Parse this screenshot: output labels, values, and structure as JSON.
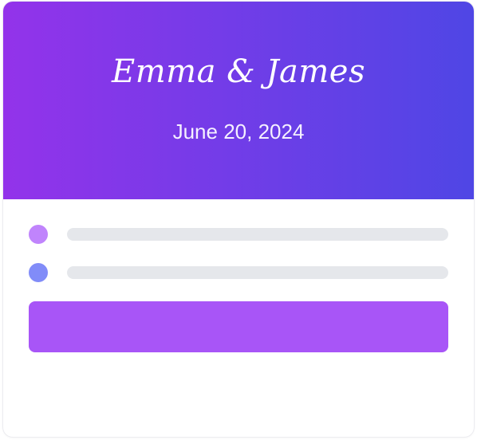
{
  "card": {
    "title": "Emma & James",
    "date": "June 20, 2024"
  },
  "colors": {
    "gradient_start": "#9333ea",
    "gradient_end": "#4f46e5",
    "dot_1": "#c084fc",
    "dot_2": "#818cf8",
    "placeholder_line": "#e5e7eb",
    "button": "#a855f7"
  }
}
